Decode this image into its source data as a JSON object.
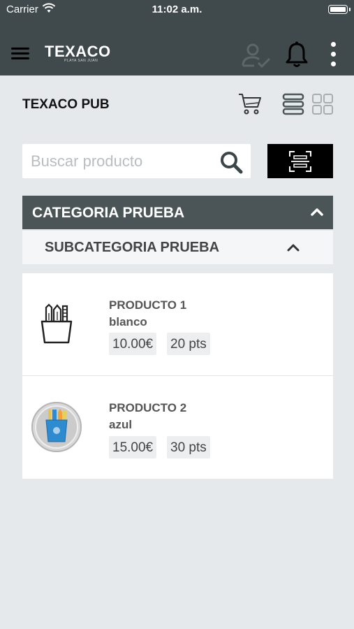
{
  "status": {
    "carrier": "Carrier",
    "time": "11:02 a.m."
  },
  "header": {
    "brand": "TEXACO",
    "tagline": "PLAYA SAN JUAN"
  },
  "store": {
    "name": "TEXACO PUB"
  },
  "search": {
    "placeholder": "Buscar producto",
    "value": ""
  },
  "category": {
    "label": "CATEGORIA PRUEBA"
  },
  "subcategory": {
    "label": "SUBCATEGORIA PRUEBA"
  },
  "products": [
    {
      "name": "PRODUCTO 1",
      "color": "blanco",
      "price": "10.00€",
      "points": "20 pts"
    },
    {
      "name": "PRODUCTO 2",
      "color": "azul",
      "price": "15.00€",
      "points": "30 pts"
    }
  ],
  "icons": {
    "menu": "hamburger-icon",
    "user_check": "user-check-icon",
    "bell": "bell-icon",
    "more": "more-vertical-icon",
    "cart": "cart-icon",
    "list_view": "list-view-icon",
    "grid_view": "grid-view-icon",
    "search": "search-icon",
    "scan": "barcode-scan-icon",
    "chevron": "chevron-up-icon"
  },
  "colors": {
    "topbar": "#404a4d",
    "category": "#4b5558",
    "background": "#e6e9ec",
    "accent_blue": "#2f8bd0"
  }
}
